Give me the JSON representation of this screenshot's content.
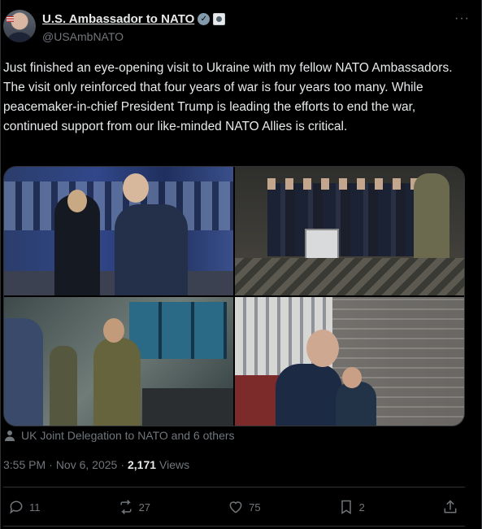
{
  "author": {
    "name": "U.S. Ambassador to NATO",
    "handle": "@USAmbNATO",
    "verified_icon": "verified-badge-icon",
    "affiliation_icon": "government-seal-icon"
  },
  "tweet": {
    "text": "Just finished an eye-opening visit to Ukraine with my fellow NATO Ambassadors. The visit only reinforced that four years of war is four years too many. While peacemaker-in-chief President Trump is leading the efforts to end the war, continued support from our like-minded NATO Allies is critical."
  },
  "tagged": {
    "text": "UK Joint Delegation to NATO and 6 others",
    "icon": "person-icon"
  },
  "meta": {
    "time": "3:55 PM",
    "separator1": "·",
    "date": "Nov 6, 2025",
    "separator2": "·",
    "views_count": "2,171",
    "views_label": "Views"
  },
  "actions": {
    "replies": "11",
    "reposts": "27",
    "likes": "75",
    "bookmarks": "2"
  }
}
